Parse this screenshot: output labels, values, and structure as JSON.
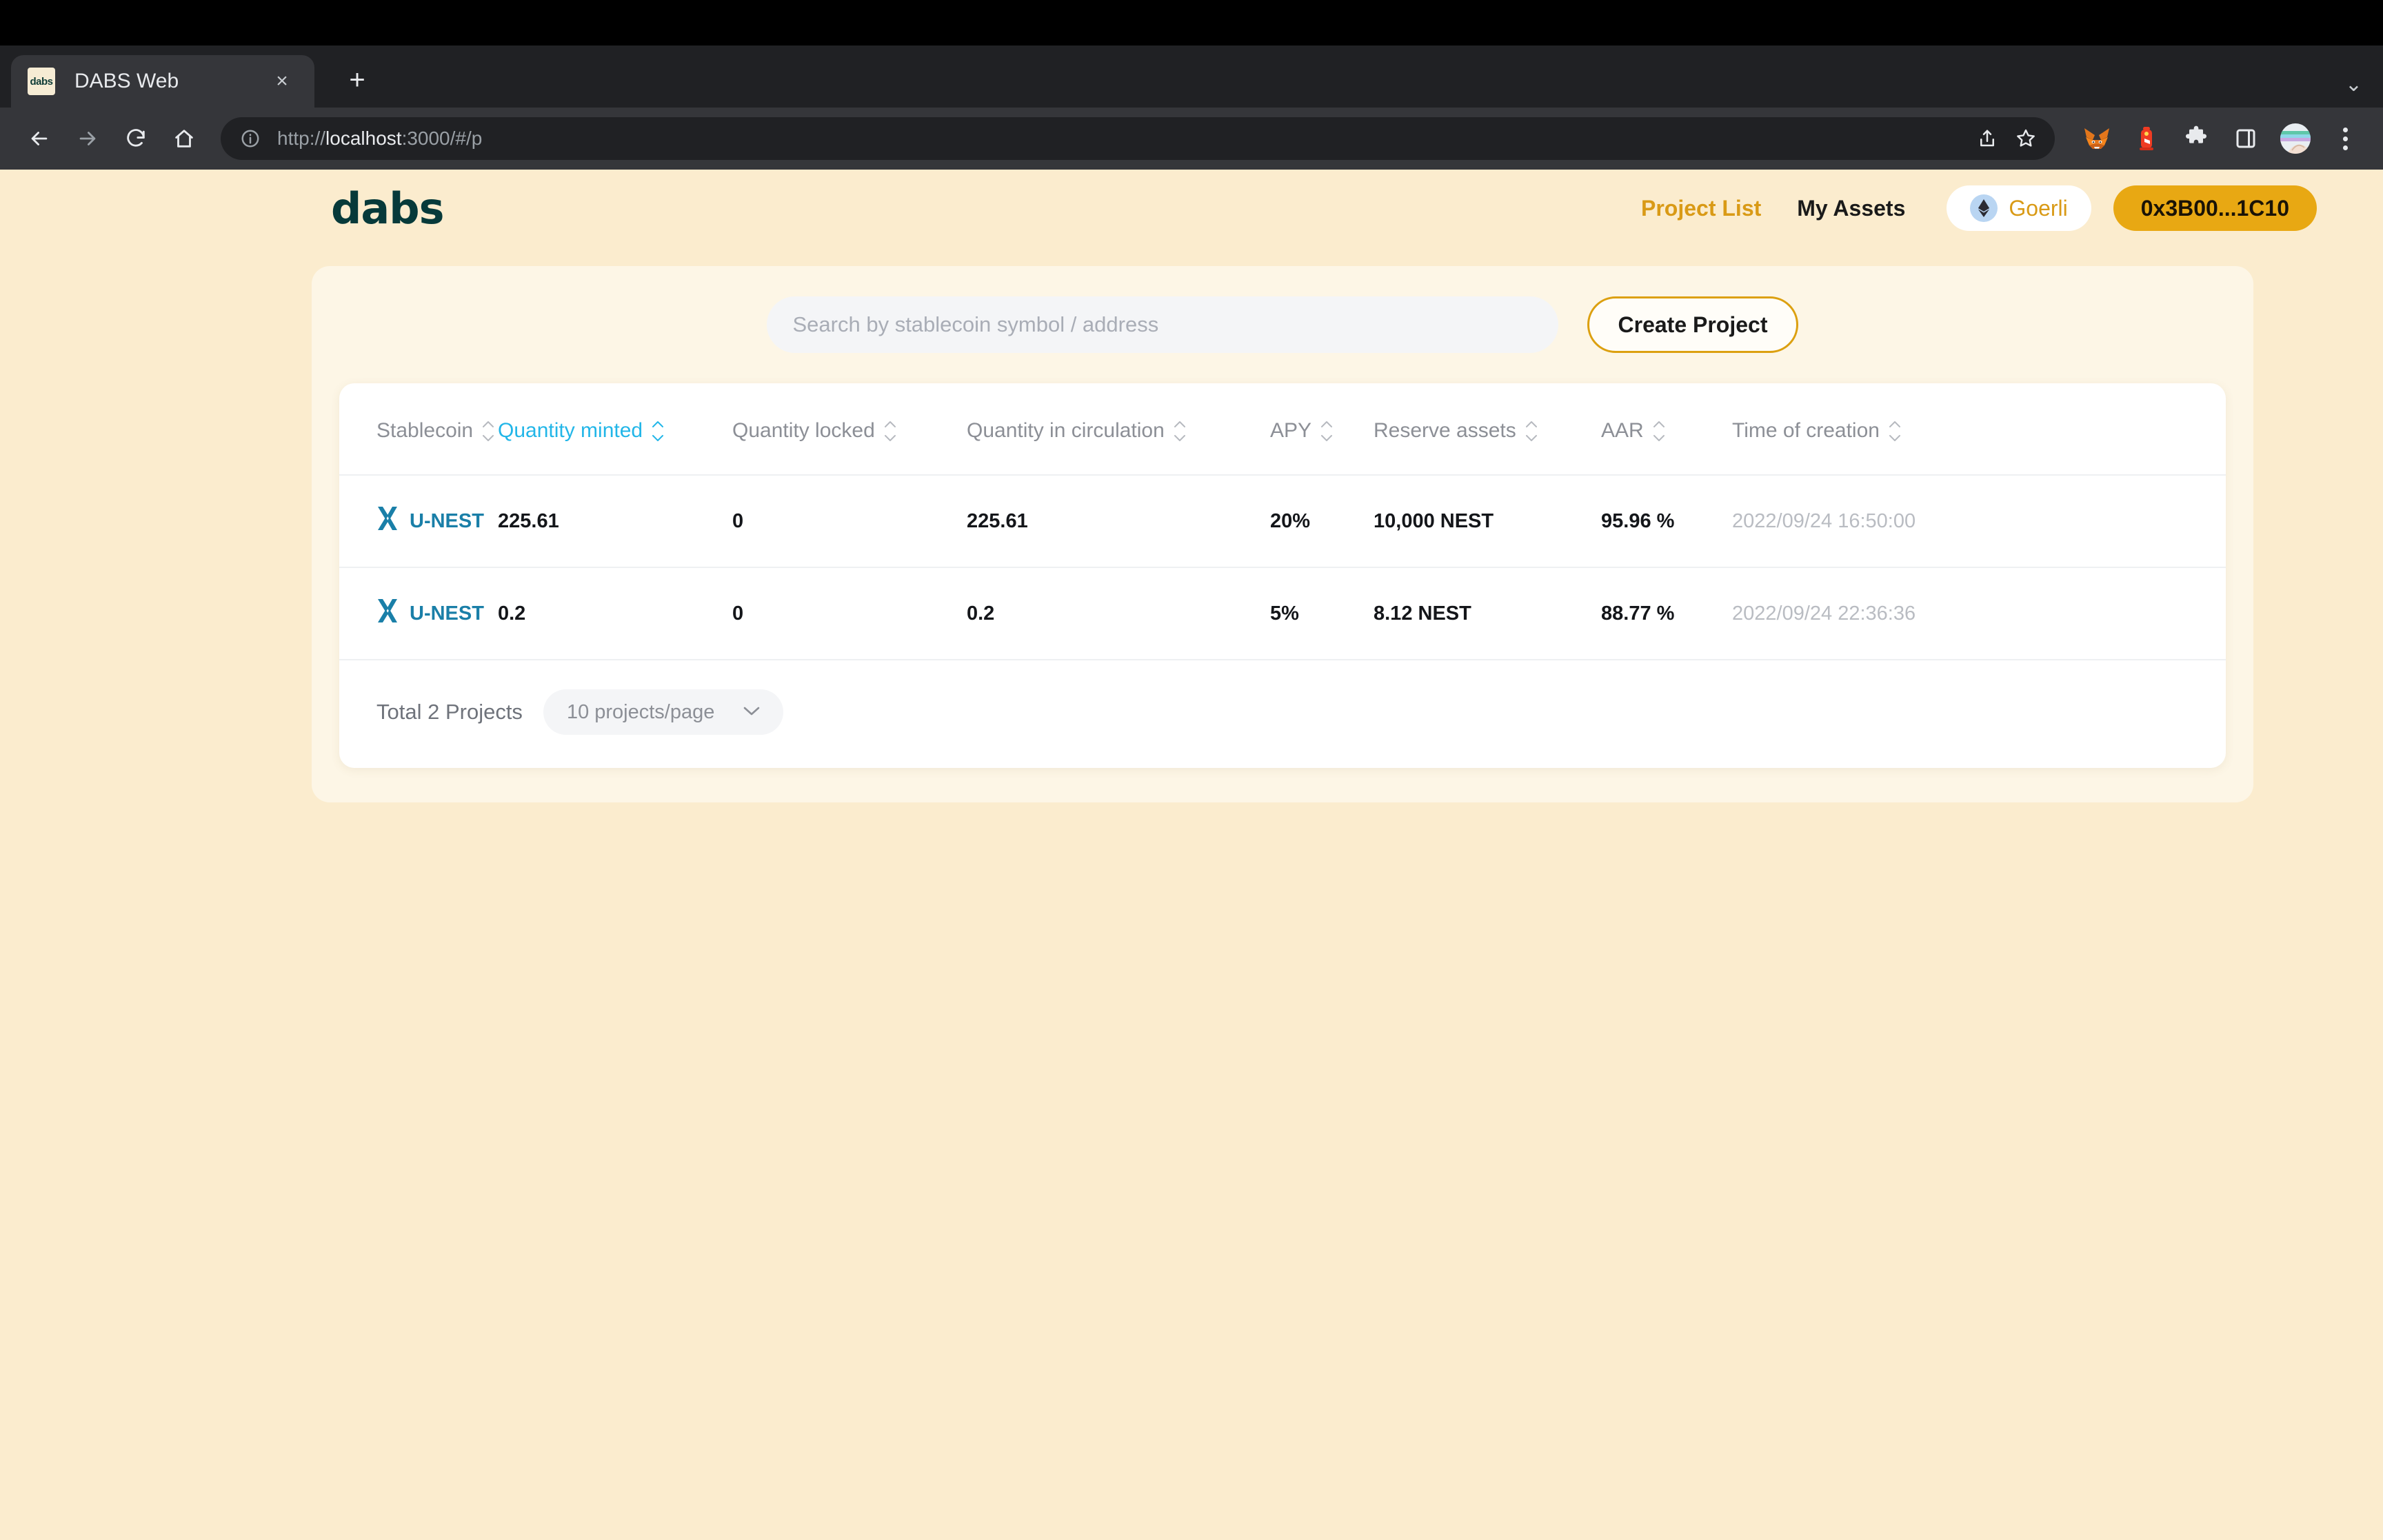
{
  "browser": {
    "tab": {
      "title": "DABS Web",
      "favicon_text": "dabs"
    },
    "new_tab_label": "+",
    "close_label": "×",
    "tablist_chevron": "⌄",
    "url_scheme": "http://",
    "url_host": "localhost",
    "url_rest": ":3000/#/p",
    "extensions": [
      {
        "name": "metamask-extension-icon"
      },
      {
        "name": "hydrant-extension-icon"
      },
      {
        "name": "extensions-puzzle-icon"
      },
      {
        "name": "side-panel-icon"
      },
      {
        "name": "profile-avatar"
      }
    ]
  },
  "header": {
    "logo": "dabs",
    "nav": [
      {
        "label": "Project List",
        "active": true
      },
      {
        "label": "My Assets",
        "active": false
      }
    ],
    "network": {
      "name": "Goerli"
    },
    "wallet": {
      "address": "0x3B00...1C10"
    }
  },
  "toolbar": {
    "search_placeholder": "Search by stablecoin symbol / address",
    "search_value": "",
    "create_label": "Create Project"
  },
  "table": {
    "columns": [
      {
        "label": "Stablecoin",
        "sorted": false
      },
      {
        "label": "Quantity minted",
        "sorted": true
      },
      {
        "label": "Quantity locked",
        "sorted": false
      },
      {
        "label": "Quantity in circulation",
        "sorted": false
      },
      {
        "label": "APY",
        "sorted": false
      },
      {
        "label": "Reserve assets",
        "sorted": false
      },
      {
        "label": "AAR",
        "sorted": false
      },
      {
        "label": "Time of creation",
        "sorted": false
      }
    ],
    "rows": [
      {
        "stablecoin": "U-NEST",
        "quantity_minted": "225.61",
        "quantity_locked": "0",
        "quantity_in_circulation": "225.61",
        "apy": "20%",
        "reserve_assets": "10,000 NEST",
        "aar": "95.96 %",
        "time_of_creation": "2022/09/24 16:50:00"
      },
      {
        "stablecoin": "U-NEST",
        "quantity_minted": "0.2",
        "quantity_locked": "0",
        "quantity_in_circulation": "0.2",
        "apy": "5%",
        "reserve_assets": "8.12 NEST",
        "aar": "88.77 %",
        "time_of_creation": "2022/09/24 22:36:36"
      }
    ]
  },
  "footer": {
    "total_label": "Total 2 Projects",
    "page_size_label": "10 projects/page"
  },
  "colors": {
    "page_bg": "#fbecce",
    "panel_bg": "#fdf6e6",
    "accent_gold": "#e8a813",
    "accent_gold_text": "#d99a16",
    "logo_teal": "#073a3a",
    "sort_active": "#22b6e8",
    "coin_teal": "#1a7fa8"
  }
}
